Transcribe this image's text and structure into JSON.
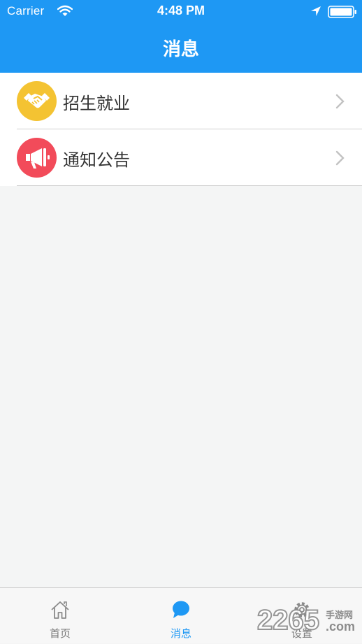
{
  "status_bar": {
    "carrier": "Carrier",
    "time": "4:48 PM",
    "icons": [
      "wifi-icon",
      "location-arrow-icon",
      "battery-icon"
    ]
  },
  "nav": {
    "title": "消息"
  },
  "list": {
    "items": [
      {
        "label": "招生就业",
        "icon": "handshake-icon",
        "icon_bg": "#f4c332"
      },
      {
        "label": "通知公告",
        "icon": "megaphone-icon",
        "icon_bg": "#f24b5a"
      }
    ]
  },
  "tab_bar": {
    "tabs": [
      {
        "label": "首页",
        "icon": "home-icon",
        "active": false
      },
      {
        "label": "消息",
        "icon": "chat-bubble-icon",
        "active": true
      },
      {
        "label": "设置",
        "icon": "gear-icon",
        "active": false
      }
    ]
  },
  "watermark": {
    "brand": "2265",
    "suffix": ".com",
    "tagline": "手游网"
  },
  "colors": {
    "accent": "#1e98f4",
    "background": "#f4f5f5",
    "inactive_tab": "#7a7a7a"
  }
}
